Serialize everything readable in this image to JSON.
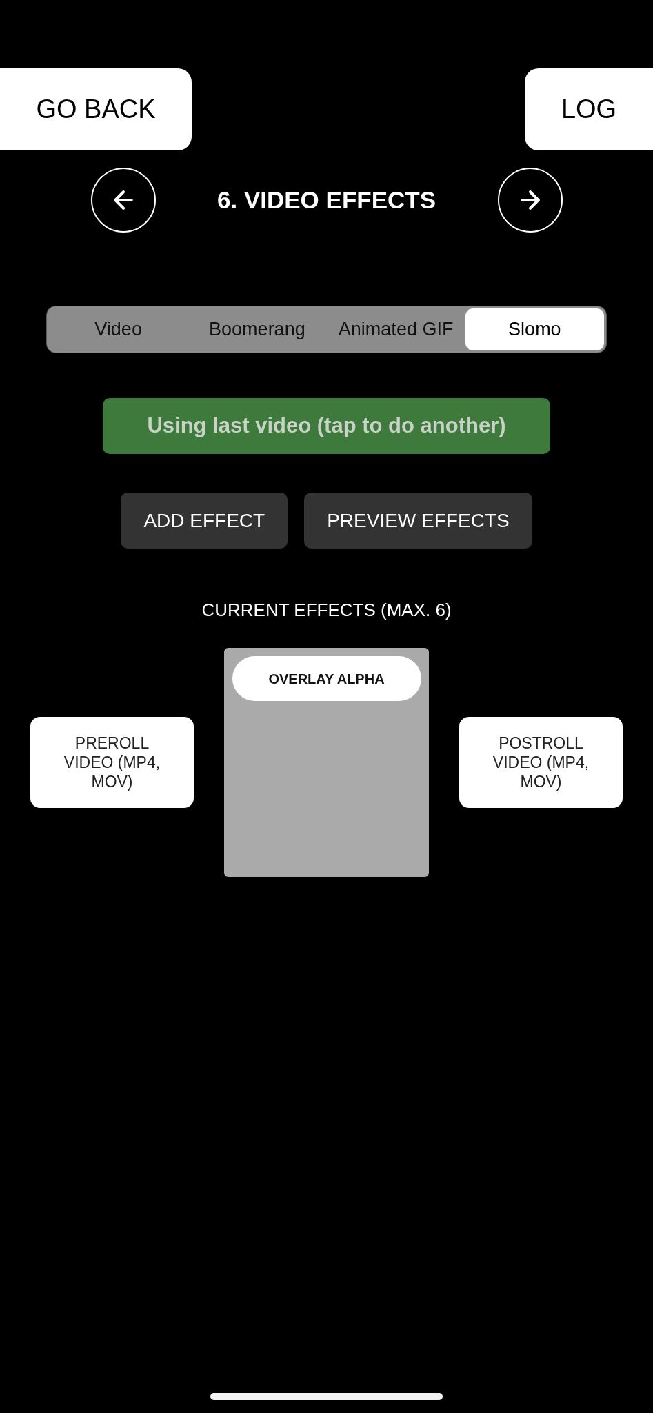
{
  "header": {
    "back_button": "GO BACK",
    "log_button": "LOG"
  },
  "step_nav": {
    "title": "6. VIDEO EFFECTS"
  },
  "media_types": [
    {
      "label": "Video",
      "selected": false
    },
    {
      "label": "Boomerang",
      "selected": false
    },
    {
      "label": "Animated GIF",
      "selected": false
    },
    {
      "label": "Slomo",
      "selected": true
    }
  ],
  "source_banner": "Using last video (tap to do another)",
  "actions": [
    "ADD EFFECT",
    "PREVIEW EFFECTS"
  ],
  "current_effects": {
    "heading": "CURRENT EFFECTS (MAX. 6)",
    "preroll": "PREROLL VIDEO (MP4, MOV)",
    "effects": [
      "OVERLAY ALPHA"
    ],
    "postroll": "POSTROLL VIDEO (MP4, MOV)"
  }
}
